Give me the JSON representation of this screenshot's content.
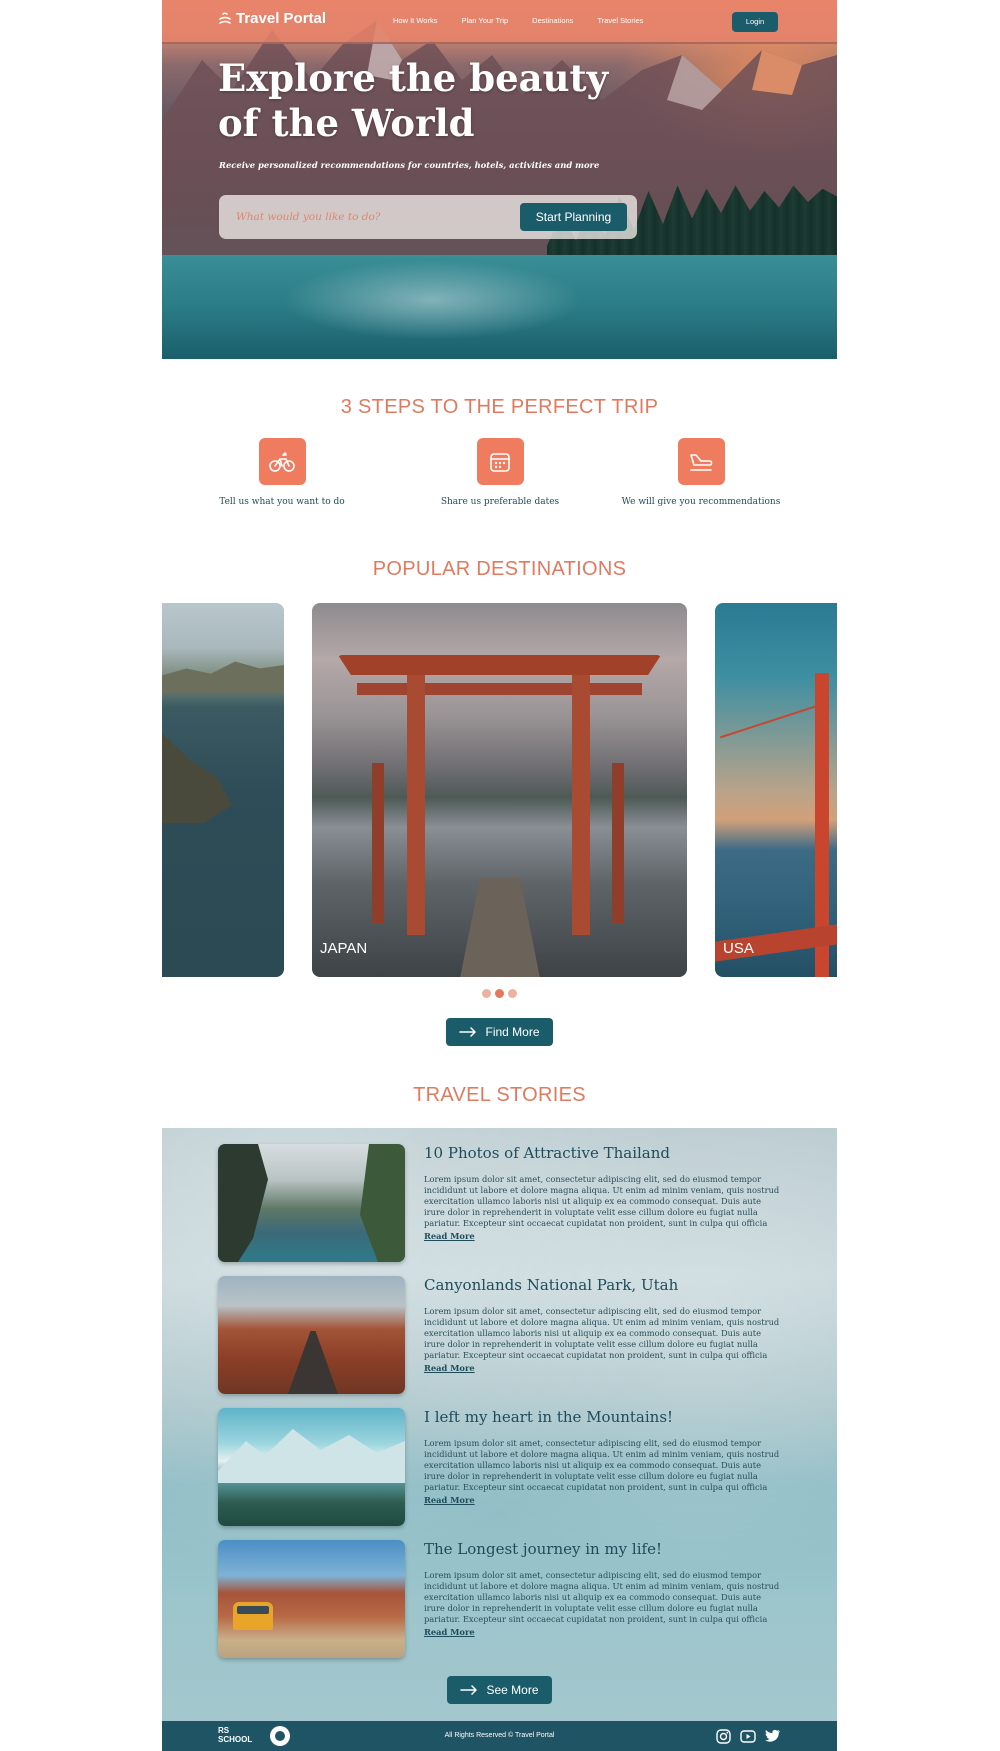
{
  "brand": {
    "name": "Travel Portal"
  },
  "nav": {
    "links": [
      "How It Works",
      "Plan Your Trip",
      "Destinations",
      "Travel Stories"
    ],
    "login": "Login"
  },
  "hero": {
    "title": "Explore the beauty of the World",
    "subtitle": "Receive personalized recommendations for countries, hotels, activities and more",
    "search_placeholder": "What would you like to do?",
    "cta": "Start Planning"
  },
  "steps": {
    "title": "3 STEPS TO THE PERFECT TRIP",
    "items": [
      {
        "label": "Tell us what you want to do",
        "icon": "bicycle-icon"
      },
      {
        "label": "Share us preferable dates",
        "icon": "calendar-icon"
      },
      {
        "label": "We will give you recommendations",
        "icon": "plane-landing-icon"
      }
    ]
  },
  "destinations": {
    "title": "POPULAR DESTINATIONS",
    "cards": [
      {
        "label": ""
      },
      {
        "label": "JAPAN"
      },
      {
        "label": "USA"
      }
    ],
    "carousel": {
      "pages": 3,
      "active": 2
    },
    "button": "Find More"
  },
  "stories": {
    "title": "TRAVEL STORIES",
    "items": [
      {
        "title": "10 Photos of Attractive Thailand",
        "text": "Lorem ipsum dolor sit amet, consectetur adipiscing elit, sed do eiusmod tempor incididunt ut labore et dolore magna aliqua. Ut enim ad minim veniam, quis nostrud exercitation ullamco laboris nisi ut aliquip ex ea commodo consequat. Duis aute irure dolor in reprehenderit in voluptate velit esse cillum dolore eu fugiat nulla pariatur. Excepteur sint occaecat cupidatat non proident, sunt in culpa qui officia deserunt mollit anim id est laborum.Lorem ipsum dolor sit amet, consectetur adipiscing elit...",
        "link": "Read More"
      },
      {
        "title": "Canyonlands National Park, Utah",
        "text": "Lorem ipsum dolor sit amet, consectetur adipiscing elit, sed do eiusmod tempor incididunt ut labore et dolore magna aliqua. Ut enim ad minim veniam, quis nostrud exercitation ullamco laboris nisi ut aliquip ex ea commodo consequat. Duis aute irure dolor in reprehenderit in voluptate velit esse cillum dolore eu fugiat nulla pariatur. Excepteur sint occaecat cupidatat non proident, sunt in culpa qui officia deserunt mollit anim id est laborum.Lorem ipsum dolor sit amet, consectetur adipiscing elit...",
        "link": "Read More"
      },
      {
        "title": "I left my heart in the Mountains!",
        "text": "Lorem ipsum dolor sit amet, consectetur adipiscing elit, sed do eiusmod tempor incididunt ut labore et dolore magna aliqua. Ut enim ad minim veniam, quis nostrud exercitation ullamco laboris nisi ut aliquip ex ea commodo consequat. Duis aute irure dolor in reprehenderit in voluptate velit esse cillum dolore eu fugiat nulla pariatur. Excepteur sint occaecat cupidatat non proident, sunt in culpa qui officia deserunt mollit anim id est laborum.Lorem ipsum dolor sit amet, consectetur adipiscing elit...",
        "link": "Read More"
      },
      {
        "title": "The Longest journey in my life!",
        "text": "Lorem ipsum dolor sit amet, consectetur adipiscing elit, sed do eiusmod tempor incididunt ut labore et dolore magna aliqua. Ut enim ad minim veniam, quis nostrud exercitation ullamco laboris nisi ut aliquip ex ea commodo consequat. Duis aute irure dolor in reprehenderit in voluptate velit esse cillum dolore eu fugiat nulla pariatur. Excepteur sint occaecat cupidatat non proident, sunt in culpa qui officia deserunt mollit anim id est laborum.Lorem ipsum dolor sit amet, consectetur adipiscing elit...",
        "link": "Read More"
      }
    ],
    "button": "See More"
  },
  "footer": {
    "school_logo": "RS SCHOOL",
    "copyright": "All Rights Reserved © Travel Portal",
    "social": [
      "instagram-icon",
      "youtube-icon",
      "twitter-icon"
    ]
  },
  "colors": {
    "accent": "#e07a5f",
    "primary": "#1b5c6b",
    "text": "#1e4c5a"
  }
}
